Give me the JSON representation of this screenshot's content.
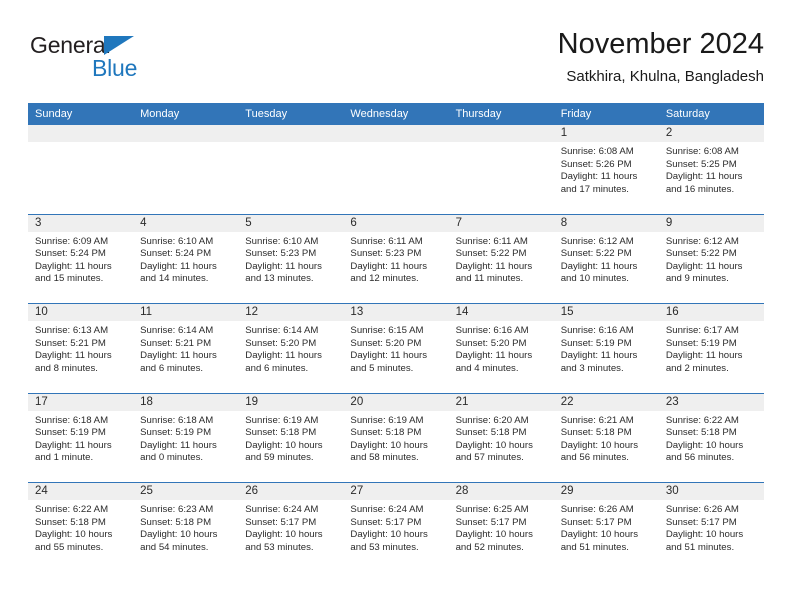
{
  "brand": {
    "name_part1": "General",
    "name_part2": "Blue",
    "triangle_color": "#1f77bd",
    "text_color": "#231f20"
  },
  "header": {
    "title": "November 2024",
    "subtitle": "Satkhira, Khulna, Bangladesh"
  },
  "theme": {
    "header_blue": "#3275b8",
    "date_band_gray": "#efefef",
    "text_color": "#2b2b2b"
  },
  "weekday_headers": [
    "Sunday",
    "Monday",
    "Tuesday",
    "Wednesday",
    "Thursday",
    "Friday",
    "Saturday"
  ],
  "weeks": [
    [
      {
        "day": "",
        "sunrise": "",
        "sunset": "",
        "daylight": ""
      },
      {
        "day": "",
        "sunrise": "",
        "sunset": "",
        "daylight": ""
      },
      {
        "day": "",
        "sunrise": "",
        "sunset": "",
        "daylight": ""
      },
      {
        "day": "",
        "sunrise": "",
        "sunset": "",
        "daylight": ""
      },
      {
        "day": "",
        "sunrise": "",
        "sunset": "",
        "daylight": ""
      },
      {
        "day": "1",
        "sunrise": "Sunrise: 6:08 AM",
        "sunset": "Sunset: 5:26 PM",
        "daylight": "Daylight: 11 hours and 17 minutes."
      },
      {
        "day": "2",
        "sunrise": "Sunrise: 6:08 AM",
        "sunset": "Sunset: 5:25 PM",
        "daylight": "Daylight: 11 hours and 16 minutes."
      }
    ],
    [
      {
        "day": "3",
        "sunrise": "Sunrise: 6:09 AM",
        "sunset": "Sunset: 5:24 PM",
        "daylight": "Daylight: 11 hours and 15 minutes."
      },
      {
        "day": "4",
        "sunrise": "Sunrise: 6:10 AM",
        "sunset": "Sunset: 5:24 PM",
        "daylight": "Daylight: 11 hours and 14 minutes."
      },
      {
        "day": "5",
        "sunrise": "Sunrise: 6:10 AM",
        "sunset": "Sunset: 5:23 PM",
        "daylight": "Daylight: 11 hours and 13 minutes."
      },
      {
        "day": "6",
        "sunrise": "Sunrise: 6:11 AM",
        "sunset": "Sunset: 5:23 PM",
        "daylight": "Daylight: 11 hours and 12 minutes."
      },
      {
        "day": "7",
        "sunrise": "Sunrise: 6:11 AM",
        "sunset": "Sunset: 5:22 PM",
        "daylight": "Daylight: 11 hours and 11 minutes."
      },
      {
        "day": "8",
        "sunrise": "Sunrise: 6:12 AM",
        "sunset": "Sunset: 5:22 PM",
        "daylight": "Daylight: 11 hours and 10 minutes."
      },
      {
        "day": "9",
        "sunrise": "Sunrise: 6:12 AM",
        "sunset": "Sunset: 5:22 PM",
        "daylight": "Daylight: 11 hours and 9 minutes."
      }
    ],
    [
      {
        "day": "10",
        "sunrise": "Sunrise: 6:13 AM",
        "sunset": "Sunset: 5:21 PM",
        "daylight": "Daylight: 11 hours and 8 minutes."
      },
      {
        "day": "11",
        "sunrise": "Sunrise: 6:14 AM",
        "sunset": "Sunset: 5:21 PM",
        "daylight": "Daylight: 11 hours and 6 minutes."
      },
      {
        "day": "12",
        "sunrise": "Sunrise: 6:14 AM",
        "sunset": "Sunset: 5:20 PM",
        "daylight": "Daylight: 11 hours and 6 minutes."
      },
      {
        "day": "13",
        "sunrise": "Sunrise: 6:15 AM",
        "sunset": "Sunset: 5:20 PM",
        "daylight": "Daylight: 11 hours and 5 minutes."
      },
      {
        "day": "14",
        "sunrise": "Sunrise: 6:16 AM",
        "sunset": "Sunset: 5:20 PM",
        "daylight": "Daylight: 11 hours and 4 minutes."
      },
      {
        "day": "15",
        "sunrise": "Sunrise: 6:16 AM",
        "sunset": "Sunset: 5:19 PM",
        "daylight": "Daylight: 11 hours and 3 minutes."
      },
      {
        "day": "16",
        "sunrise": "Sunrise: 6:17 AM",
        "sunset": "Sunset: 5:19 PM",
        "daylight": "Daylight: 11 hours and 2 minutes."
      }
    ],
    [
      {
        "day": "17",
        "sunrise": "Sunrise: 6:18 AM",
        "sunset": "Sunset: 5:19 PM",
        "daylight": "Daylight: 11 hours and 1 minute."
      },
      {
        "day": "18",
        "sunrise": "Sunrise: 6:18 AM",
        "sunset": "Sunset: 5:19 PM",
        "daylight": "Daylight: 11 hours and 0 minutes."
      },
      {
        "day": "19",
        "sunrise": "Sunrise: 6:19 AM",
        "sunset": "Sunset: 5:18 PM",
        "daylight": "Daylight: 10 hours and 59 minutes."
      },
      {
        "day": "20",
        "sunrise": "Sunrise: 6:19 AM",
        "sunset": "Sunset: 5:18 PM",
        "daylight": "Daylight: 10 hours and 58 minutes."
      },
      {
        "day": "21",
        "sunrise": "Sunrise: 6:20 AM",
        "sunset": "Sunset: 5:18 PM",
        "daylight": "Daylight: 10 hours and 57 minutes."
      },
      {
        "day": "22",
        "sunrise": "Sunrise: 6:21 AM",
        "sunset": "Sunset: 5:18 PM",
        "daylight": "Daylight: 10 hours and 56 minutes."
      },
      {
        "day": "23",
        "sunrise": "Sunrise: 6:22 AM",
        "sunset": "Sunset: 5:18 PM",
        "daylight": "Daylight: 10 hours and 56 minutes."
      }
    ],
    [
      {
        "day": "24",
        "sunrise": "Sunrise: 6:22 AM",
        "sunset": "Sunset: 5:18 PM",
        "daylight": "Daylight: 10 hours and 55 minutes."
      },
      {
        "day": "25",
        "sunrise": "Sunrise: 6:23 AM",
        "sunset": "Sunset: 5:18 PM",
        "daylight": "Daylight: 10 hours and 54 minutes."
      },
      {
        "day": "26",
        "sunrise": "Sunrise: 6:24 AM",
        "sunset": "Sunset: 5:17 PM",
        "daylight": "Daylight: 10 hours and 53 minutes."
      },
      {
        "day": "27",
        "sunrise": "Sunrise: 6:24 AM",
        "sunset": "Sunset: 5:17 PM",
        "daylight": "Daylight: 10 hours and 53 minutes."
      },
      {
        "day": "28",
        "sunrise": "Sunrise: 6:25 AM",
        "sunset": "Sunset: 5:17 PM",
        "daylight": "Daylight: 10 hours and 52 minutes."
      },
      {
        "day": "29",
        "sunrise": "Sunrise: 6:26 AM",
        "sunset": "Sunset: 5:17 PM",
        "daylight": "Daylight: 10 hours and 51 minutes."
      },
      {
        "day": "30",
        "sunrise": "Sunrise: 6:26 AM",
        "sunset": "Sunset: 5:17 PM",
        "daylight": "Daylight: 10 hours and 51 minutes."
      }
    ]
  ]
}
